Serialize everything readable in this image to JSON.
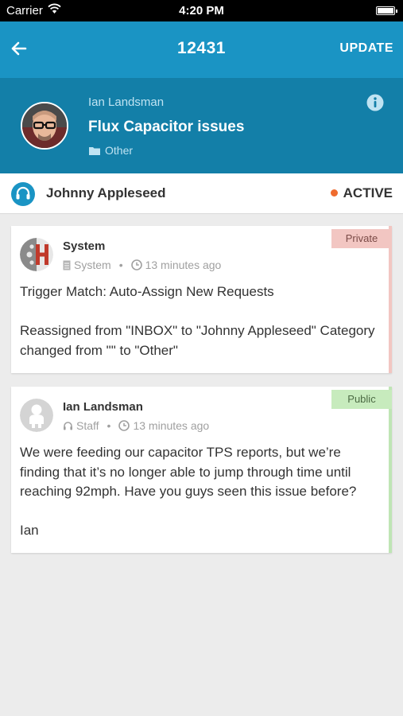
{
  "status_bar": {
    "carrier": "Carrier",
    "time": "4:20 PM"
  },
  "nav": {
    "title": "12431",
    "update_label": "UPDATE"
  },
  "ticket": {
    "requester": "Ian Landsman",
    "subject": "Flux Capacitor issues",
    "category": "Other"
  },
  "assignee": {
    "name": "Johnny Appleseed",
    "status": "ACTIVE"
  },
  "messages": [
    {
      "visibility": "Private",
      "author": "System",
      "role": "System",
      "time": "13 minutes ago",
      "paragraphs": [
        "Trigger Match: Auto-Assign New Requests",
        "Reassigned from \"INBOX\" to \"Johnny Appleseed\" Category changed from \"\" to \"Other\""
      ]
    },
    {
      "visibility": "Public",
      "author": "Ian Landsman",
      "role": "Staff",
      "time": "13 minutes ago",
      "paragraphs": [
        "We were feeding our capacitor TPS reports, but we’re finding that it’s no longer able to jump through time until reaching 92mph. Have you guys seen this issue before?",
        "Ian"
      ]
    }
  ],
  "colors": {
    "nav_bg": "#1a94c4",
    "header_bg": "#137fa8",
    "active_dot": "#ef6b2e",
    "private_badge": "#f2c6c2",
    "public_badge": "#c7ebbd"
  }
}
